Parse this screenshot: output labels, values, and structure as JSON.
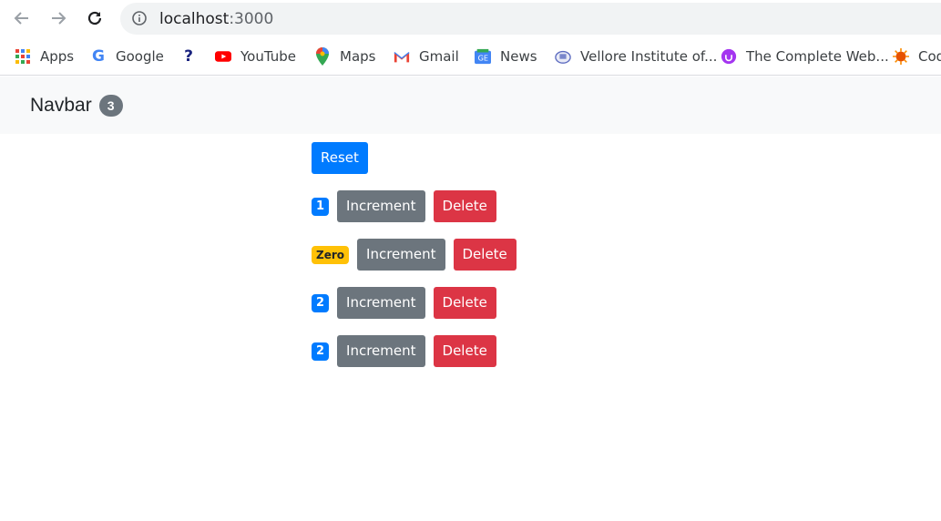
{
  "browser": {
    "url_host": "localhost",
    "url_port": ":3000",
    "bookmarks": [
      {
        "label": "Apps",
        "icon": "apps-grid-icon"
      },
      {
        "label": "Google",
        "icon": "google-icon"
      },
      {
        "label": "",
        "icon": "bookmark-favicon-icon"
      },
      {
        "label": "YouTube",
        "icon": "youtube-icon"
      },
      {
        "label": "Maps",
        "icon": "maps-icon"
      },
      {
        "label": "Gmail",
        "icon": "gmail-icon"
      },
      {
        "label": "News",
        "icon": "news-icon"
      },
      {
        "label": "Vellore Institute of...",
        "icon": "vit-icon"
      },
      {
        "label": "The Complete Web...",
        "icon": "udemy-icon"
      },
      {
        "label": "Cod",
        "icon": "code-icon"
      }
    ]
  },
  "navbar": {
    "brand": "Navbar",
    "count": "3"
  },
  "reset_label": "Reset",
  "counters": [
    {
      "value": "1",
      "variant": "primary",
      "increment_label": "Increment",
      "delete_label": "Delete"
    },
    {
      "value": "Zero",
      "variant": "warning",
      "increment_label": "Increment",
      "delete_label": "Delete"
    },
    {
      "value": "2",
      "variant": "primary",
      "increment_label": "Increment",
      "delete_label": "Delete"
    },
    {
      "value": "2",
      "variant": "primary",
      "increment_label": "Increment",
      "delete_label": "Delete"
    }
  ],
  "colors": {
    "primary": "#007bff",
    "secondary": "#6c757d",
    "danger": "#dc3545",
    "warning": "#ffc107",
    "navbar_bg": "#f8f9fa"
  }
}
